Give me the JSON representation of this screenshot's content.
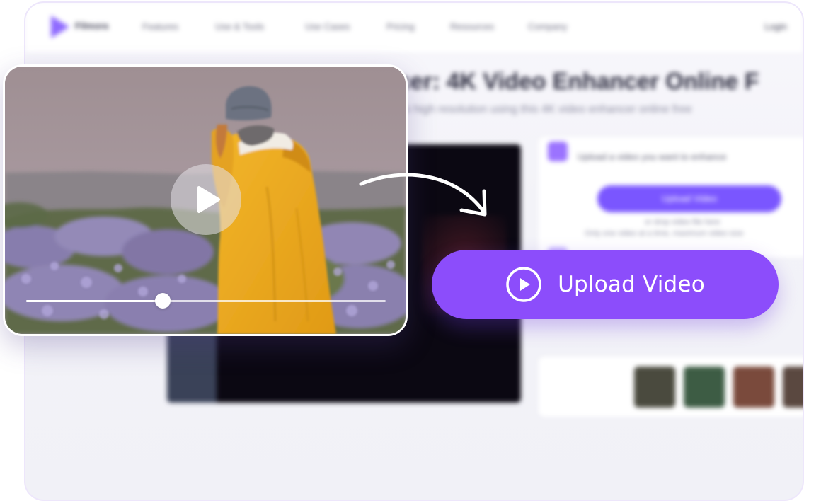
{
  "colors": {
    "accent": "#8c4dfb",
    "backdrop_accent": "#7a56ff",
    "card_border": "#ffffff",
    "frame_border": "#ede6fb"
  },
  "icons": {
    "play_overlay": "play-icon",
    "upload_button": "play-circle-icon",
    "arrow": "curved-arrow-icon",
    "brand": "brand-logo-icon"
  },
  "backdrop": {
    "brand": "Filmora",
    "nav": [
      "Features",
      "Use & Tools",
      "Use Cases",
      "Pricing",
      "Resources",
      "Company"
    ],
    "login": "Login",
    "title": "ncer: 4K Video Enhancer Online F",
    "subtitle": "o high resolution using this 4K video enhancer online free",
    "step1_text": "Upload a video you want to enhance",
    "upload_button": "Upload Video",
    "or_text": "or drop video file here",
    "note": "Only one video at a time, maximum video size"
  },
  "video_card": {
    "progress": 0.38
  },
  "upload": {
    "label": "Upload Video"
  }
}
